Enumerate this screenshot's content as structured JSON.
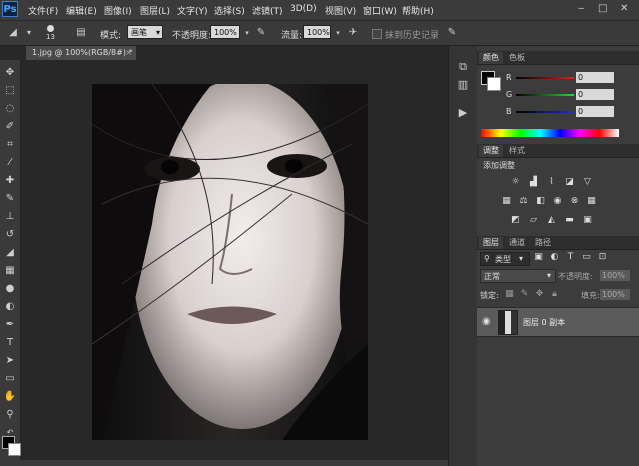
{
  "app": {
    "logo": "Ps"
  },
  "menu": [
    "文件(F)",
    "编辑(E)",
    "图像(I)",
    "图层(L)",
    "文字(Y)",
    "选择(S)",
    "滤镜(T)",
    "3D(D)",
    "视图(V)",
    "窗口(W)",
    "帮助(H)"
  ],
  "window_controls": [
    "‒",
    "□",
    "✕"
  ],
  "options": {
    "brush_size": "13",
    "mode_label": "模式:",
    "mode_value": "画笔",
    "opacity_label": "不透明度:",
    "opacity_value": "100%",
    "flow_label": "流量:",
    "flow_value": "100%",
    "history_label": "抹到历史记录"
  },
  "document": {
    "tab_title": "1.jpg @ 100%(RGB/8#) *"
  },
  "panels": {
    "color": {
      "tabs": [
        "颜色",
        "色板"
      ],
      "channels": [
        {
          "label": "R",
          "value": "0",
          "color": "#c03030"
        },
        {
          "label": "G",
          "value": "0",
          "color": "#30c030"
        },
        {
          "label": "B",
          "value": "0",
          "color": "#3040d0"
        }
      ]
    },
    "adjustments": {
      "tabs": [
        "调整",
        "样式"
      ],
      "title": "添加调整"
    },
    "layers": {
      "tabs": [
        "图层",
        "通道",
        "路径"
      ],
      "filter_label": "类型",
      "blend_mode": "正常",
      "opacity_label": "不透明度:",
      "opacity_value": "100%",
      "lock_label": "锁定:",
      "fill_label": "填充:",
      "fill_value": "100%",
      "layer_name": "图层 0 副本"
    }
  }
}
